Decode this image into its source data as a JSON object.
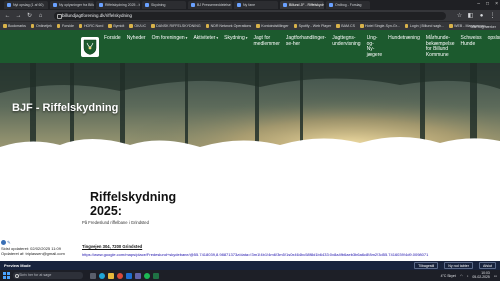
{
  "browser": {
    "tabs": [
      {
        "label": "Nyt opslag (1 af 60)"
      },
      {
        "label": "Ny oplysninger fra Billund"
      },
      {
        "label": "Riffelskydning 2025 - bjf"
      },
      {
        "label": "Skydning"
      },
      {
        "label": "BJ Pressemeddelelse"
      },
      {
        "label": "Ny fane"
      },
      {
        "label": "Billund JF - Riffelskydning"
      },
      {
        "label": "Ordbog - Forslag"
      }
    ],
    "url": "billundjagtforening.dk/riffelskydning",
    "bookmarks": [
      "Bookmarks",
      "Onlinetjek",
      "Forside",
      "HORC Nord",
      "Bymidt",
      "OK/LIC",
      "DANSK RIFFELSKYDNING",
      "NDR Network Operations",
      "Kontoindstillinger",
      "Spotify - Web Player",
      "BAM.CS",
      "Hotel Single-Syn-Gr...",
      "Login | Billund sagb...",
      "WEB - Managemen..."
    ],
    "bookmarks_right": "Alle bogmærker"
  },
  "site": {
    "nav": [
      {
        "label": "Forside",
        "caret": false
      },
      {
        "label": "Nyheder",
        "caret": false
      },
      {
        "label": "Om foreningen",
        "caret": true
      },
      {
        "label": "Aktiviteter",
        "caret": true
      },
      {
        "label": "Skydning",
        "caret": true
      },
      {
        "label": "Jagt for\nmedlemmer",
        "caret": false
      },
      {
        "label": "Jagtforhandlinger-\nse-her",
        "caret": false
      },
      {
        "label": "Jagttegns-\nundervisning",
        "caret": false
      },
      {
        "label": "Ung-\nog-\nNy-\njægere",
        "caret": false
      },
      {
        "label": "Hundetræning",
        "caret": false
      },
      {
        "label": "Mårhunde-\nbekæmpelse\nfor Billund\nKommune",
        "caret": false
      },
      {
        "label": "Schweiss\nHunde",
        "caret": false
      },
      {
        "label": "opslsrifter",
        "caret": true
      }
    ],
    "hero_title": "BJF - Riffelskydning",
    "page_title": "Riffelskydning 2025:",
    "subtitle": "På Fredeslund riffelbane i Grindsted",
    "meta_line1": "Sidst opdateret: 02/02/2025 11:09",
    "meta_line2": "Opdateret af: triplassen@gmail.com",
    "place_label": "Tingvejen 304, 7200 Grindsted",
    "map_link": "https://www.google.com/maps/place/Fredeslund+skydebane/@55.7418039,8.98871373z/data=!3m1!4b1!4m6!3m5!1s0x464bc58f8d1b6433:0x8a4fb6aeb3b6a6c8!8m2!3d55.7416039!4d9.0098071"
  },
  "status_bar": {
    "label": "Preview Mode",
    "buttons": [
      "Tilbagestil",
      "Ny rod tabter",
      "Afslut"
    ]
  },
  "taskbar": {
    "search_placeholder": "Skriv her for at søge",
    "weather": "4°C Skyet",
    "time": "10:03",
    "date": "05-02-2025"
  },
  "colors": {
    "nav_green": "#1c5a2e",
    "browser_dark": "#35363a",
    "status_navy": "#18233d"
  }
}
